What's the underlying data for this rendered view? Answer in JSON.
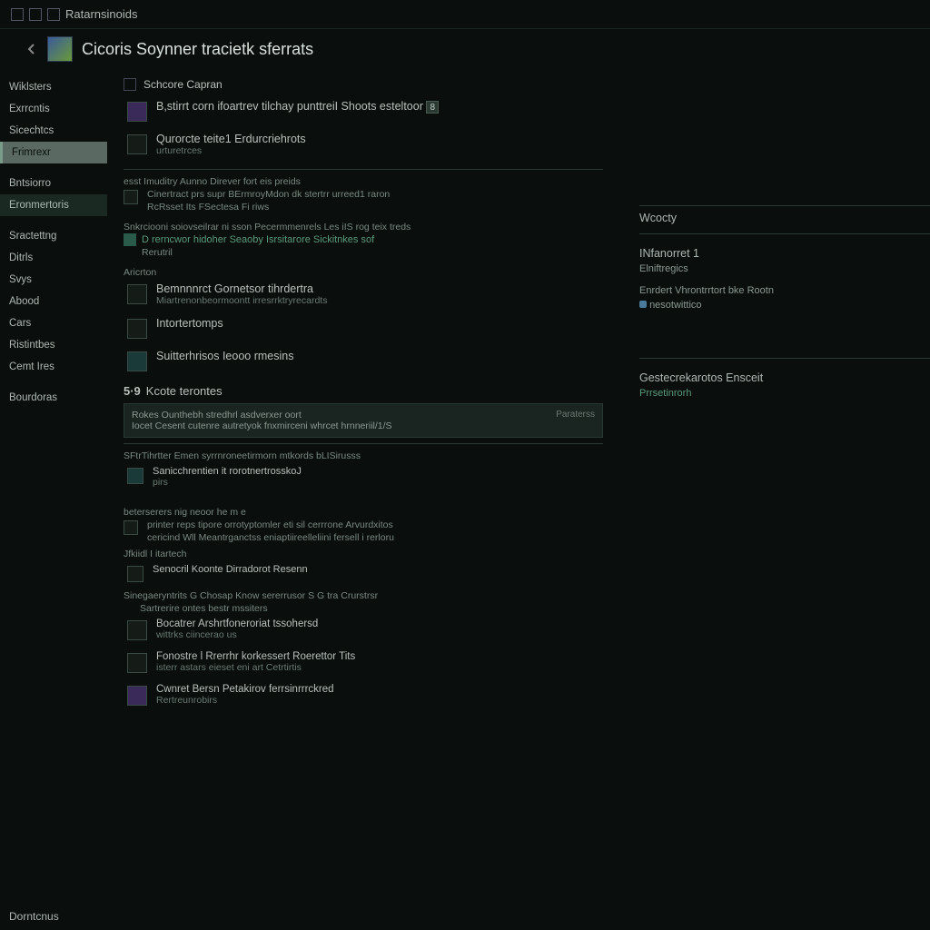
{
  "header": {
    "breadcrumb": "Ratarnsinoids"
  },
  "title": "Cicoris Soynner tracietk sferrats",
  "sidebar": {
    "items": [
      {
        "label": "Wiklsters"
      },
      {
        "label": "Exrrcntis"
      },
      {
        "label": "Sicechtcs"
      },
      {
        "label": "Frimrexr"
      },
      {
        "label": "Bntsiorro"
      },
      {
        "label": "Eronmertoris"
      },
      {
        "label": "Sractettng"
      },
      {
        "label": "Ditrls"
      },
      {
        "label": "Svys"
      },
      {
        "label": "Abood"
      },
      {
        "label": "Cars"
      },
      {
        "label": "Ristintbes"
      },
      {
        "label": "Cemt Ires"
      },
      {
        "label": "Bourdoras"
      }
    ],
    "selected_index": 3,
    "alt_selected_index": 5,
    "footer": "Dorntcnus"
  },
  "center": {
    "heading1": "Schcore Capran",
    "item1": {
      "text": "B,stirrt corn ifoartrev tilchay punttreiI Shoots esteltoor",
      "badge": "8"
    },
    "item2": {
      "text": "Qurorcte teite1 Erdurcriehrots",
      "sub": "urturetrces"
    },
    "subtexts1": [
      "esst Imuditry Aunno Direver fort eis preids",
      "Cinertract prs supr BErmroyMdon dk stertrr urreed1 raron",
      "RcRsset Its FSectesa Fi riws"
    ],
    "subtexts2": [
      "Snkrciooni soiovseilrar ni sson Pecermmenrels Les iIS rog teix treds"
    ],
    "green1": "D rerncwor hidoher Seaoby Isrsitarore Sickitnkes sof",
    "sublabel1": "Rerutril",
    "sec3_label": "Aricrton",
    "item3": {
      "text": "Bemnnnrct Gornetsor tihrdertra",
      "sub": "Miartrenonbeormoontt irresrrktryrecardts"
    },
    "item4": {
      "text": "Intortertomps"
    },
    "item5": {
      "text": "Suitterhrisos Ieooo rmesins"
    },
    "sec5": {
      "num": "5·9",
      "label": "Kcote terontes"
    },
    "bar": {
      "line1": "Rokes Ounthebh stredhrl asdverxer oort",
      "line2": "Iocet Cesent cutenre autretyok fnxmirceni whrcet hrnneriil/1/S",
      "right": "Paraterss"
    },
    "subtexts3": [
      "SFtrTihrtter Emen syrrnroneetirmorn mtkords bLISirusss"
    ],
    "item6": {
      "text": "Sanicchrentien it rorotnertrosskoJ",
      "sub": "pirs"
    },
    "subtexts4": [
      "beterserers nig neoor he m e",
      "printer reps tipore orrotyptomler eti sil cerrrone Arvurdxitos",
      "cericind Wll Meantrganctss eniaptiireelleliini fersell i rerloru"
    ],
    "sublabel2": "Jfkiidl I itartech",
    "item7": {
      "text": "Senocril Koonte Dirradorot Resenn"
    },
    "subtexts5": [
      "Sinegaeryntrits G Chosap Know sererrusor S G tra Crurstrsr"
    ],
    "sublabel3": "Sartrerire ontes bestr mssiters",
    "item8": {
      "text": "Bocatrer Arshrtfoneroriat tssohersd",
      "sub": "wittrks ciincerao us"
    },
    "item9": {
      "text": "Fonostre l Rrerrhr korkessert Roerettor Tits",
      "sub": "isterr astars eieset eni art Cetrtirtis"
    },
    "item10": {
      "text": "Cwnret Bersn Petakirov ferrsinrrrckred",
      "sub": "Rertreunrobirs"
    }
  },
  "right": {
    "heading1": "Wcocty",
    "heading2": "INfanorret 1",
    "sub2": "Elniftregics",
    "sub3": "Enrdert Vhrontrrtort bke Rootn",
    "dot_label": "nesotwittico",
    "heading3": "Gestecrekarotos Ensceit",
    "link3": "Prrsetinrorh"
  }
}
